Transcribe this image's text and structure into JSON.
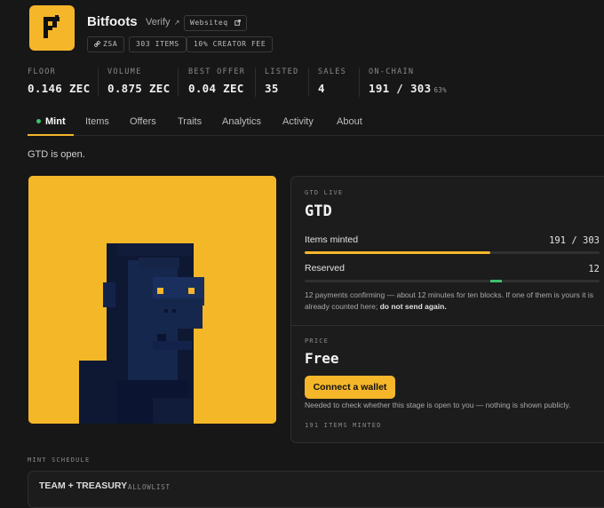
{
  "collection": {
    "name": "Bitfoots",
    "verify_label": "Verify",
    "website_label": "Websiteq",
    "chips": [
      "ZSA",
      "303 ITEMS",
      "10% CREATOR FEE"
    ]
  },
  "stats": [
    {
      "label": "FLOOR",
      "value": "0.146 ZEC"
    },
    {
      "label": "VOLUME",
      "value": "0.875 ZEC"
    },
    {
      "label": "BEST OFFER",
      "value": "0.04 ZEC"
    },
    {
      "label": "LISTED",
      "value": "35"
    },
    {
      "label": "SALES",
      "value": "4"
    },
    {
      "label": "ON-CHAIN",
      "value": "191 / 303",
      "extra": "63%"
    }
  ],
  "tabs": [
    "Mint",
    "Items",
    "Offers",
    "Traits",
    "Analytics",
    "Activity",
    "About"
  ],
  "active_tab": "Mint",
  "notice": "GTD is open.",
  "mint_panel": {
    "stage_label": "GTD LIVE",
    "stage_name": "GTD",
    "items_minted_label": "Items minted",
    "items_minted_value": "191 / 303",
    "items_minted_fraction": 0.63,
    "reserved_label": "Reserved",
    "reserved_value": "12",
    "note_text": "12 payments confirming — about 12 minutes for ten blocks. If one of them is yours it is already counted here;",
    "note_bold": "do not send again.",
    "price_label": "PRICE",
    "price_value": "Free",
    "connect_button": "Connect a wallet",
    "connect_note": "Needed to check whether this stage is open to you — nothing is shown publicly.",
    "minted_footer": "191 ITEMS MINTED"
  },
  "schedule": {
    "label": "MINT SCHEDULE",
    "first_name": "TEAM + TREASURY",
    "first_tag": "ALLOWLIST"
  },
  "colors": {
    "accent": "#f5b62a",
    "live_dot": "#3fbf6a",
    "background": "#171717",
    "ape_dark": "#0e1833",
    "ape_face": "#16274d",
    "eye": "#f5b62a"
  },
  "icons": {
    "logo": "bitfoots-logo",
    "verify": "external-arrow-icon",
    "website": "external-link-icon",
    "chain": "link-icon"
  }
}
